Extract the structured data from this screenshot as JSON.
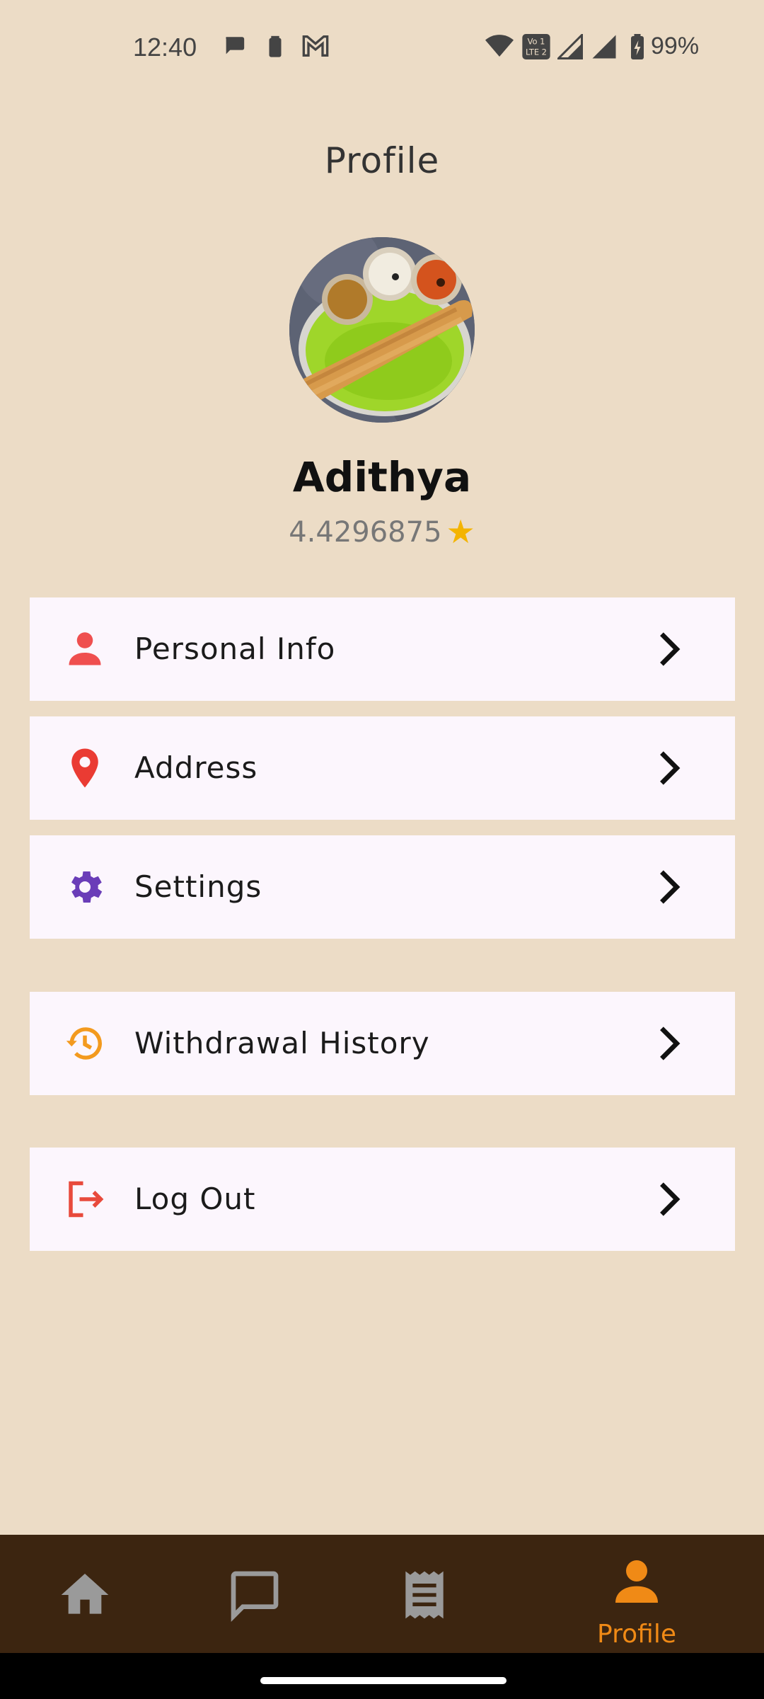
{
  "status_bar": {
    "time": "12:40",
    "battery_percent": "99%",
    "icons": [
      "chat-bubble-icon",
      "battery-small-icon",
      "gmail-icon",
      "wifi-icon",
      "volte-icon",
      "signal-icon",
      "signal-icon",
      "battery-charging-icon"
    ]
  },
  "header": {
    "title": "Profile"
  },
  "profile": {
    "name": "Adithya",
    "rating": "4.4296875",
    "rating_icon": "star-icon",
    "star_color": "#f4b400"
  },
  "menu": {
    "personal_info": {
      "label": "Personal Info",
      "icon": "person-icon"
    },
    "address": {
      "label": "Address",
      "icon": "location-pin-icon"
    },
    "settings": {
      "label": "Settings",
      "icon": "gear-icon"
    },
    "withdrawal_history": {
      "label": "Withdrawal History",
      "icon": "history-icon"
    },
    "logout": {
      "label": "Log Out",
      "icon": "logout-icon"
    }
  },
  "bottom_nav": {
    "items": [
      {
        "icon": "home-icon",
        "label": ""
      },
      {
        "icon": "chat-icon",
        "label": ""
      },
      {
        "icon": "receipt-icon",
        "label": ""
      },
      {
        "icon": "person-icon",
        "label": "Profile",
        "active": true
      }
    ],
    "active_color": "#f08a16",
    "inactive_color": "#9a9a9a",
    "background": "#3c2510"
  },
  "colors": {
    "background": "#ecdcc6",
    "card": "#fcf6fd",
    "accent": "#f08a16"
  }
}
